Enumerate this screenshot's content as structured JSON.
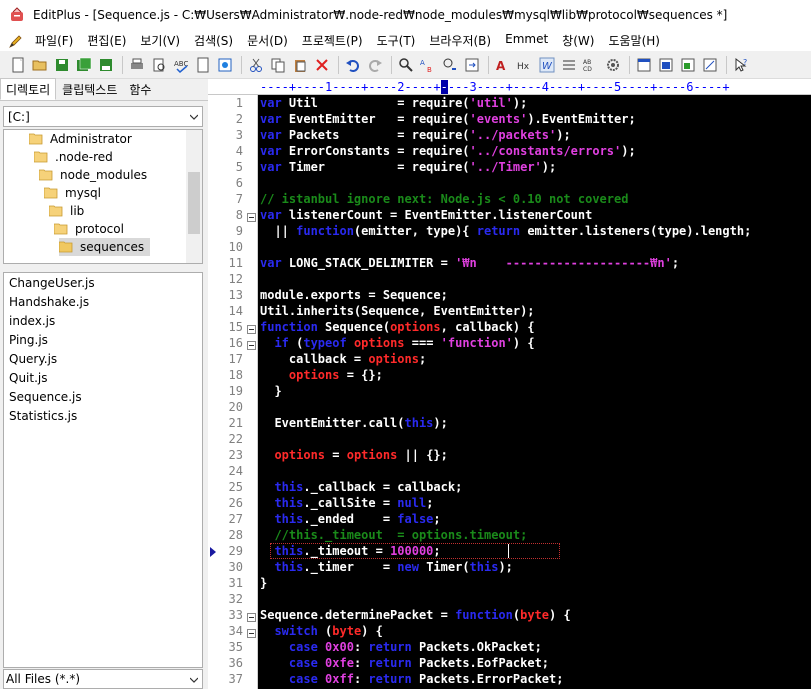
{
  "window": {
    "title": "EditPlus - [Sequence.js - C:₩Users₩Administrator₩.node-red₩node_modules₩mysql₩lib₩protocol₩sequences *]"
  },
  "menu": [
    "파일(F)",
    "편집(E)",
    "보기(V)",
    "검색(S)",
    "문서(D)",
    "프로젝트(P)",
    "도구(T)",
    "브라우저(B)",
    "Emmet",
    "창(W)",
    "도움말(H)"
  ],
  "toolbar": {
    "icons": [
      "new-file-icon",
      "open-folder-icon",
      "save-icon",
      "save-all-icon",
      "save-as-icon",
      "print-icon",
      "print-preview-icon",
      "spell-check-icon",
      "new-doc-icon",
      "browser-icon",
      "cut-icon",
      "copy-icon",
      "paste-icon",
      "delete-icon",
      "undo-icon",
      "redo-icon",
      "find-icon",
      "replace-icon",
      "find-next-icon",
      "goto-icon",
      "font-icon",
      "hex-icon",
      "word-wrap-icon",
      "column-select-icon",
      "abcd-icon",
      "settings-icon",
      "window-icon",
      "window2-icon",
      "window3-icon",
      "window4-icon",
      "help-icon"
    ]
  },
  "left_panel": {
    "tabs": [
      "디렉토리",
      "클립텍스트",
      "함수"
    ],
    "drive": "[C:]",
    "tree": [
      {
        "label": "Administrator",
        "indent": 1
      },
      {
        "label": ".node-red",
        "indent": 2
      },
      {
        "label": "node_modules",
        "indent": 3
      },
      {
        "label": "mysql",
        "indent": 4
      },
      {
        "label": "lib",
        "indent": 5
      },
      {
        "label": "protocol",
        "indent": 6
      },
      {
        "label": "sequences",
        "indent": 7,
        "selected": true
      }
    ],
    "files": [
      "ChangeUser.js",
      "Handshake.js",
      "index.js",
      "Ping.js",
      "Query.js",
      "Quit.js",
      "Sequence.js",
      "Statistics.js"
    ],
    "filter": "All Files (*.*)"
  },
  "editor": {
    "ruler": "----+----1----+----2----+----3----+----4----+----5----+----6----+",
    "line_numbers": [
      1,
      2,
      3,
      4,
      5,
      6,
      7,
      8,
      9,
      10,
      11,
      12,
      13,
      14,
      15,
      16,
      17,
      18,
      19,
      20,
      21,
      22,
      23,
      24,
      25,
      26,
      27,
      28,
      29,
      30,
      31,
      32,
      33,
      34,
      35,
      36,
      37
    ],
    "fold_lines": [
      8,
      15,
      16,
      33,
      34
    ],
    "current_line": 29,
    "lines": [
      [
        [
          "k",
          "var "
        ],
        [
          "t",
          "Util           = require("
        ],
        [
          "s",
          "'util'"
        ],
        [
          "t",
          ");"
        ]
      ],
      [
        [
          "k",
          "var "
        ],
        [
          "t",
          "EventEmitter   = require("
        ],
        [
          "s",
          "'events'"
        ],
        [
          "t",
          ").EventEmitter;"
        ]
      ],
      [
        [
          "k",
          "var "
        ],
        [
          "t",
          "Packets        = require("
        ],
        [
          "s",
          "'../packets'"
        ],
        [
          "t",
          ");"
        ]
      ],
      [
        [
          "k",
          "var "
        ],
        [
          "t",
          "ErrorConstants = require("
        ],
        [
          "s",
          "'../constants/errors'"
        ],
        [
          "t",
          ");"
        ]
      ],
      [
        [
          "k",
          "var "
        ],
        [
          "t",
          "Timer          = require("
        ],
        [
          "s",
          "'../Timer'"
        ],
        [
          "t",
          ");"
        ]
      ],
      [],
      [
        [
          "c",
          "// istanbul ignore next: Node.js < 0.10 not covered"
        ]
      ],
      [
        [
          "k",
          "var "
        ],
        [
          "t",
          "listenerCount = EventEmitter.listenerCount"
        ]
      ],
      [
        [
          "t",
          "  || "
        ],
        [
          "k",
          "function"
        ],
        [
          "t",
          "(emitter, type){ "
        ],
        [
          "k",
          "return"
        ],
        [
          "t",
          " emitter.listeners(type).length;"
        ]
      ],
      [],
      [
        [
          "k",
          "var "
        ],
        [
          "t",
          "LONG_STACK_DELIMITER = "
        ],
        [
          "s",
          "'₩n    --------------------₩n'"
        ],
        [
          "t",
          ";"
        ]
      ],
      [],
      [
        [
          "t",
          "module.exports = Sequence;"
        ]
      ],
      [
        [
          "t",
          "Util.inherits(Sequence, EventEmitter);"
        ]
      ],
      [
        [
          "k",
          "function "
        ],
        [
          "t",
          "Sequence("
        ],
        [
          "r",
          "options"
        ],
        [
          "t",
          ", callback) {"
        ]
      ],
      [
        [
          "t",
          "  "
        ],
        [
          "k",
          "if"
        ],
        [
          "t",
          " ("
        ],
        [
          "k",
          "typeof"
        ],
        [
          "r",
          " options"
        ],
        [
          "t",
          " === "
        ],
        [
          "s",
          "'function'"
        ],
        [
          "t",
          ") {"
        ]
      ],
      [
        [
          "t",
          "    callback = "
        ],
        [
          "r",
          "options"
        ],
        [
          "t",
          ";"
        ]
      ],
      [
        [
          "t",
          "    "
        ],
        [
          "r",
          "options"
        ],
        [
          "t",
          " = {};"
        ]
      ],
      [
        [
          "t",
          "  }"
        ]
      ],
      [],
      [
        [
          "t",
          "  EventEmitter.call("
        ],
        [
          "k",
          "this"
        ],
        [
          "t",
          ");"
        ]
      ],
      [],
      [
        [
          "t",
          "  "
        ],
        [
          "r",
          "options"
        ],
        [
          "t",
          " = "
        ],
        [
          "r",
          "options"
        ],
        [
          "t",
          " || {};"
        ]
      ],
      [],
      [
        [
          "t",
          "  "
        ],
        [
          "k",
          "this"
        ],
        [
          "t",
          "._callback = callback;"
        ]
      ],
      [
        [
          "t",
          "  "
        ],
        [
          "k",
          "this"
        ],
        [
          "t",
          "._callSite = "
        ],
        [
          "k",
          "null"
        ],
        [
          "t",
          ";"
        ]
      ],
      [
        [
          "t",
          "  "
        ],
        [
          "k",
          "this"
        ],
        [
          "t",
          "._ended    = "
        ],
        [
          "k",
          "false"
        ],
        [
          "t",
          ";"
        ]
      ],
      [
        [
          "c",
          "  //this._timeout  = options.timeout;"
        ]
      ],
      [
        [
          "t",
          "  "
        ],
        [
          "k",
          "this"
        ],
        [
          "t",
          "._timeout = "
        ],
        [
          "n",
          "100000"
        ],
        [
          "t",
          ";"
        ]
      ],
      [
        [
          "t",
          "  "
        ],
        [
          "k",
          "this"
        ],
        [
          "t",
          "._timer    = "
        ],
        [
          "k",
          "new"
        ],
        [
          "t",
          " Timer("
        ],
        [
          "k",
          "this"
        ],
        [
          "t",
          ");"
        ]
      ],
      [
        [
          "t",
          "}"
        ]
      ],
      [],
      [
        [
          "t",
          "Sequence.determinePacket = "
        ],
        [
          "k",
          "function"
        ],
        [
          "t",
          "("
        ],
        [
          "r",
          "byte"
        ],
        [
          "t",
          ") {"
        ]
      ],
      [
        [
          "t",
          "  "
        ],
        [
          "k",
          "switch"
        ],
        [
          "t",
          " ("
        ],
        [
          "r",
          "byte"
        ],
        [
          "t",
          ") {"
        ]
      ],
      [
        [
          "t",
          "    "
        ],
        [
          "k",
          "case "
        ],
        [
          "n",
          "0x00"
        ],
        [
          "t",
          ": "
        ],
        [
          "k",
          "return"
        ],
        [
          "t",
          " Packets.OkPacket;"
        ]
      ],
      [
        [
          "t",
          "    "
        ],
        [
          "k",
          "case "
        ],
        [
          "n",
          "0xfe"
        ],
        [
          "t",
          ": "
        ],
        [
          "k",
          "return"
        ],
        [
          "t",
          " Packets.EofPacket;"
        ]
      ],
      [
        [
          "t",
          "    "
        ],
        [
          "k",
          "case "
        ],
        [
          "n",
          "0xff"
        ],
        [
          "t",
          ": "
        ],
        [
          "k",
          "return"
        ],
        [
          "t",
          " Packets.ErrorPacket;"
        ]
      ]
    ]
  },
  "colors": {
    "keyword": "#2a2af0",
    "string": "#e040e0",
    "comment": "#1a8a1a",
    "identifier": "#ff2a2a",
    "editor_bg": "#000000",
    "text": "#ffffff"
  }
}
